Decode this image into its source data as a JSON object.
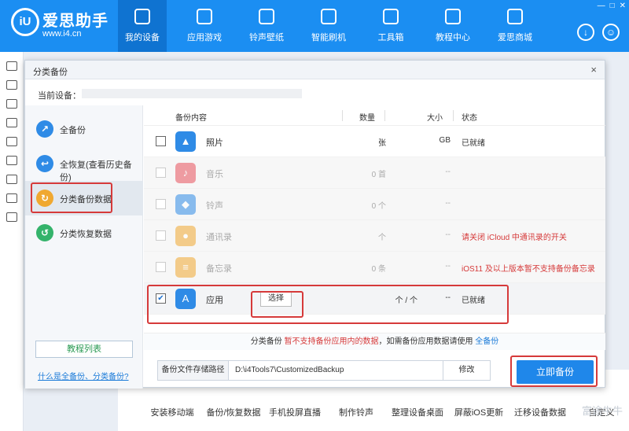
{
  "app": {
    "brand": "爱思助手",
    "url": "www.i4.cn",
    "logo": "iU"
  },
  "nav": [
    {
      "label": "我的设备",
      "icon": "phone-icon",
      "active": true
    },
    {
      "label": "应用游戏",
      "icon": "appstore-icon"
    },
    {
      "label": "铃声壁纸",
      "icon": "music-icon"
    },
    {
      "label": "智能刷机",
      "icon": "refresh-icon"
    },
    {
      "label": "工具箱",
      "icon": "toolbox-icon"
    },
    {
      "label": "教程中心",
      "icon": "graduation-cap-icon"
    },
    {
      "label": "爱思商城",
      "icon": "store-icon"
    }
  ],
  "dialog": {
    "title": "分类备份",
    "close": "×",
    "device_label": "当前设备：",
    "sidebar": [
      {
        "label": "全备份",
        "color": "#2f8be6",
        "icon": "↗"
      },
      {
        "label": "全恢复(查看历史备份)",
        "color": "#2f8be6",
        "icon": "↩"
      },
      {
        "label": "分类备份数据",
        "color": "#f0a830",
        "icon": "↻"
      },
      {
        "label": "分类恢复数据",
        "color": "#34b36b",
        "icon": "↺"
      }
    ],
    "tutorial_btn": "教程列表",
    "faq_link": "什么是全备份、分类备份?",
    "headers": {
      "content": "备份内容",
      "count": "数量",
      "size": "大小",
      "status": "状态"
    },
    "rows": [
      {
        "name": "照片",
        "count": "张",
        "size": "GB",
        "status": "已就绪",
        "checked": false,
        "dim": false,
        "color": "#2f8be6",
        "icon": "▲"
      },
      {
        "name": "音乐",
        "count": "0 首",
        "size": "--",
        "status": "",
        "checked": false,
        "dim": true,
        "color": "#e8505b",
        "icon": "♪"
      },
      {
        "name": "铃声",
        "count": "0 个",
        "size": "--",
        "status": "",
        "checked": false,
        "dim": true,
        "color": "#2f8be6",
        "icon": "◆"
      },
      {
        "name": "通讯录",
        "count": "个",
        "size": "--",
        "status": "请关闭 iCloud 中通讯录的开关",
        "checked": false,
        "dim": true,
        "color": "#f0a830",
        "icon": "●",
        "status_red": true
      },
      {
        "name": "备忘录",
        "count": "0 条",
        "size": "--",
        "status": "iOS11 及以上版本暂不支持备份备忘录",
        "checked": false,
        "dim": true,
        "color": "#f0a830",
        "icon": "≡",
        "status_red": true
      },
      {
        "name": "应用",
        "count": "个 /      个",
        "size": "--",
        "status": "已就绪",
        "checked": true,
        "dim": false,
        "color": "#2f8be6",
        "icon": "A",
        "choose": "选择"
      }
    ],
    "note_a": "分类备份 ",
    "note_b": "暂不支持备份应用内的数据",
    "note_c": "，如需备份应用数据请使用 ",
    "note_d": "全备份",
    "path_label": "备份文件存储路径",
    "path": "D:\\i4Tools7\\CustomizedBackup",
    "modify": "修改",
    "backup_now": "立即备份"
  },
  "tools": [
    "安装移动端",
    "备份/恢复数据",
    "手机投屏直播",
    "制作铃声",
    "整理设备桌面",
    "屏蔽iOS更新",
    "迁移设备数据",
    "自定义"
  ],
  "watermark": "富途牛牛"
}
